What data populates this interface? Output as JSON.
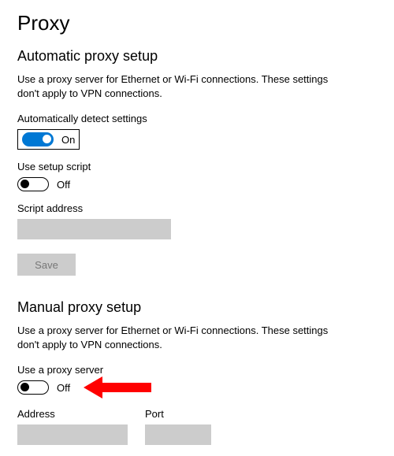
{
  "title": "Proxy",
  "auto": {
    "heading": "Automatic proxy setup",
    "description": "Use a proxy server for Ethernet or Wi-Fi connections. These settings don't apply to VPN connections.",
    "detect": {
      "label": "Automatically detect settings",
      "state": "On",
      "on": true
    },
    "script": {
      "label": "Use setup script",
      "state": "Off",
      "on": false
    },
    "scriptAddress": {
      "label": "Script address",
      "value": ""
    },
    "saveLabel": "Save"
  },
  "manual": {
    "heading": "Manual proxy setup",
    "description": "Use a proxy server for Ethernet or Wi-Fi connections. These settings don't apply to VPN connections.",
    "useProxy": {
      "label": "Use a proxy server",
      "state": "Off",
      "on": false
    },
    "address": {
      "label": "Address",
      "value": ""
    },
    "port": {
      "label": "Port",
      "value": ""
    }
  }
}
